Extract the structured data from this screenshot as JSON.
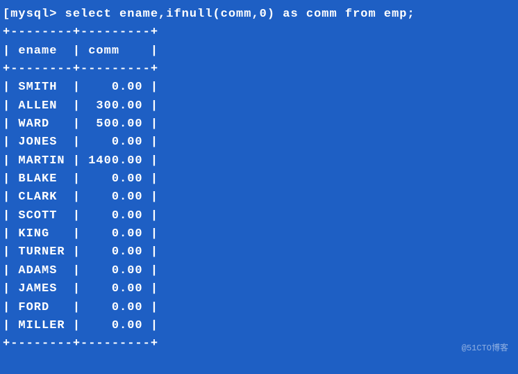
{
  "prompt_bracket": "[",
  "prompt_label": "mysql> ",
  "query": "select ename,ifnull(comm,0) as comm from emp;",
  "border": "+--------+---------+",
  "header_line": "| ename  | comm    |",
  "columns": [
    "ename",
    "comm"
  ],
  "rows": [
    {
      "ename": "SMITH",
      "comm": "0.00"
    },
    {
      "ename": "ALLEN",
      "comm": "300.00"
    },
    {
      "ename": "WARD",
      "comm": "500.00"
    },
    {
      "ename": "JONES",
      "comm": "0.00"
    },
    {
      "ename": "MARTIN",
      "comm": "1400.00"
    },
    {
      "ename": "BLAKE",
      "comm": "0.00"
    },
    {
      "ename": "CLARK",
      "comm": "0.00"
    },
    {
      "ename": "SCOTT",
      "comm": "0.00"
    },
    {
      "ename": "KING",
      "comm": "0.00"
    },
    {
      "ename": "TURNER",
      "comm": "0.00"
    },
    {
      "ename": "ADAMS",
      "comm": "0.00"
    },
    {
      "ename": "JAMES",
      "comm": "0.00"
    },
    {
      "ename": "FORD",
      "comm": "0.00"
    },
    {
      "ename": "MILLER",
      "comm": "0.00"
    }
  ],
  "watermark": "@51CTO博客",
  "chart_data": {
    "type": "table",
    "title": "select ename,ifnull(comm,0) as comm from emp;",
    "columns": [
      "ename",
      "comm"
    ],
    "rows": [
      [
        "SMITH",
        0.0
      ],
      [
        "ALLEN",
        300.0
      ],
      [
        "WARD",
        500.0
      ],
      [
        "JONES",
        0.0
      ],
      [
        "MARTIN",
        1400.0
      ],
      [
        "BLAKE",
        0.0
      ],
      [
        "CLARK",
        0.0
      ],
      [
        "SCOTT",
        0.0
      ],
      [
        "KING",
        0.0
      ],
      [
        "TURNER",
        0.0
      ],
      [
        "ADAMS",
        0.0
      ],
      [
        "JAMES",
        0.0
      ],
      [
        "FORD",
        0.0
      ],
      [
        "MILLER",
        0.0
      ]
    ]
  }
}
